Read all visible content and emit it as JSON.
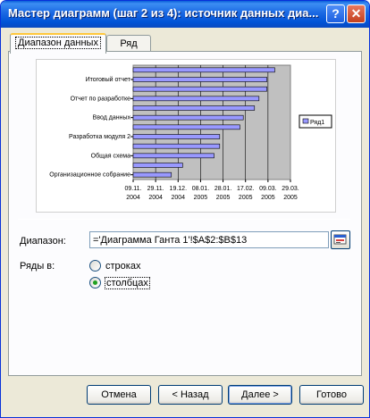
{
  "window": {
    "title": "Мастер диаграмм (шаг 2 из 4): источник данных диа...",
    "help_label": "?",
    "close_label": "✕"
  },
  "tabs": [
    {
      "label": "Диапазон данных",
      "active": true
    },
    {
      "label": "Ряд",
      "active": false
    }
  ],
  "chart_data": {
    "type": "bar",
    "orientation": "horizontal",
    "categories": [
      "Организационное собрание",
      "",
      "Общая схема",
      "",
      "Разработка модуля 2",
      "",
      "Ввод данных",
      "",
      "Отчет по разработке",
      "",
      "Итоговый отчет",
      ""
    ],
    "category_labels": [
      "Организационное собрание",
      "Общая схема",
      "Разработка модуля 2",
      "Ввод данных",
      "Отчет по разработке",
      "Итоговый отчет"
    ],
    "series": [
      {
        "name": "Ряд1",
        "values": [
          "2004-12-13",
          "2004-12-23",
          "2005-01-20",
          "2005-01-25",
          "2005-01-25",
          "2005-02-12",
          "2005-02-15",
          "2005-02-25",
          "2005-03-01",
          "2005-03-08",
          "2005-03-08",
          "2005-03-15"
        ]
      }
    ],
    "x_ticks": [
      "09.11.\n2004",
      "29.11.\n2004",
      "19.12.\n2004",
      "08.01.\n2005",
      "28.01.\n2005",
      "17.02.\n2005",
      "09.03.\n2005",
      "29.03.\n2005"
    ],
    "xlim": [
      "2004-11-09",
      "2005-03-29"
    ],
    "legend": "right",
    "grid": true,
    "plot_background": "#c0c0c0",
    "bar_color": "#9999ff"
  },
  "form": {
    "range_label": "Диапазон:",
    "range_value": "='Диаграмма Ганта 1'!$A$2:$B$13",
    "series_in_label": "Ряды в:",
    "rows_label": "строках",
    "columns_label": "столбцах",
    "selected": "columns"
  },
  "buttons": {
    "cancel": "Отмена",
    "back": "< Назад",
    "next": "Далее >",
    "finish": "Готово"
  }
}
